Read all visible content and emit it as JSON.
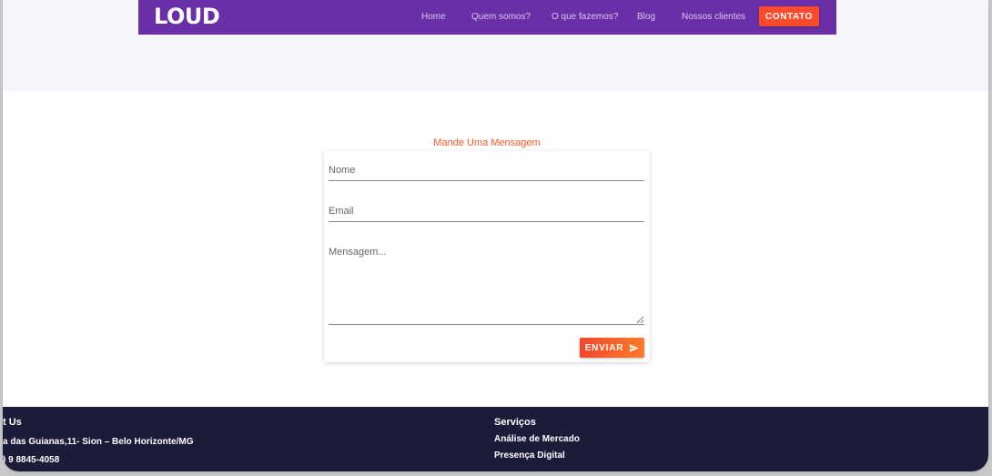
{
  "navbar": {
    "logo": "LOUD",
    "links": [
      "Home",
      "Quem somos?",
      "O que fazemos?",
      "Blog",
      "Nossos clientes"
    ],
    "cta": "CONTATO",
    "background": "#6a2fa6",
    "cta_color": "#ff4a2b"
  },
  "contact_form": {
    "title": "Mande Uma Mensagem",
    "name_placeholder": "Nome",
    "email_placeholder": "Email",
    "message_placeholder": "Mensagem...",
    "submit_label": "ENVIAR",
    "submit_icon": "send-icon",
    "accent": "#f25a2c"
  },
  "footer": {
    "contact_heading": "t Us",
    "address": "a das Guianas,11- Sion – Belo Horizonte/MG",
    "phone": ") 9 8845-4058",
    "services_heading": "Serviços",
    "services": [
      "Análise de Mercado",
      "Presença Digital"
    ],
    "background": "#1d1b3a"
  }
}
